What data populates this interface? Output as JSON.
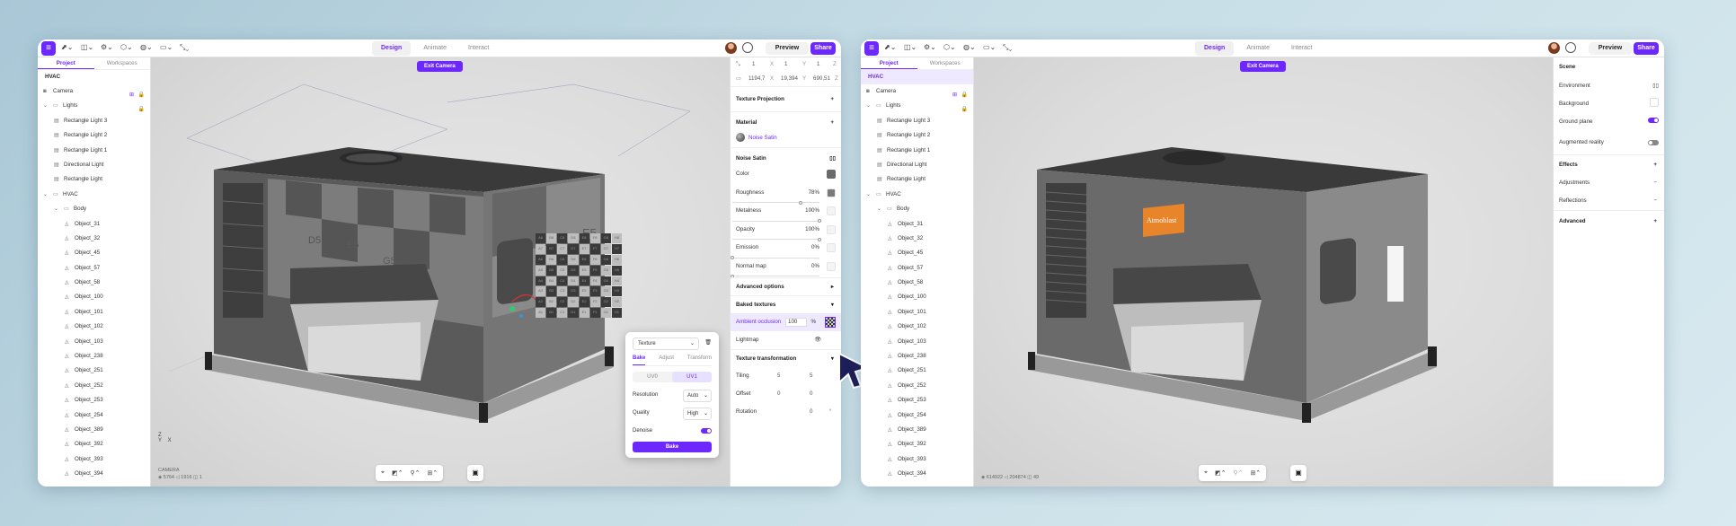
{
  "topbar": {
    "modes": [
      "Design",
      "Animate",
      "Interact"
    ],
    "preview_label": "Preview",
    "share_label": "Share"
  },
  "left_panel": {
    "tabs": [
      "Project",
      "Workspaces"
    ],
    "root_title": "HVAC",
    "items": [
      {
        "label": "Camera",
        "indent": 0,
        "icon": "camera-icon"
      },
      {
        "label": "Lights",
        "indent": 0,
        "icon": "folder-icon",
        "chevron": true
      },
      {
        "label": "Rectangle Light 3",
        "indent": 1,
        "icon": "light-icon"
      },
      {
        "label": "Rectangle Light 2",
        "indent": 1,
        "icon": "light-icon"
      },
      {
        "label": "Rectangle Light 1",
        "indent": 1,
        "icon": "light-icon"
      },
      {
        "label": "Directional Light",
        "indent": 1,
        "icon": "light-icon"
      },
      {
        "label": "Rectangle Light",
        "indent": 1,
        "icon": "light-icon"
      },
      {
        "label": "HVAC",
        "indent": 0,
        "icon": "folder-icon",
        "chevron": true
      },
      {
        "label": "Body",
        "indent": 1,
        "icon": "folder-icon",
        "chevron": true
      },
      {
        "label": "Object_31",
        "indent": 2,
        "icon": "mesh-icon"
      },
      {
        "label": "Object_32",
        "indent": 2,
        "icon": "mesh-icon"
      },
      {
        "label": "Object_45",
        "indent": 2,
        "icon": "mesh-icon"
      },
      {
        "label": "Object_57",
        "indent": 2,
        "icon": "mesh-icon"
      },
      {
        "label": "Object_58",
        "indent": 2,
        "icon": "mesh-icon"
      },
      {
        "label": "Object_100",
        "indent": 2,
        "icon": "mesh-icon"
      },
      {
        "label": "Object_101",
        "indent": 2,
        "icon": "mesh-icon"
      },
      {
        "label": "Object_102",
        "indent": 2,
        "icon": "mesh-icon"
      },
      {
        "label": "Object_103",
        "indent": 2,
        "icon": "mesh-icon"
      },
      {
        "label": "Object_238",
        "indent": 2,
        "icon": "mesh-icon"
      },
      {
        "label": "Object_251",
        "indent": 2,
        "icon": "mesh-icon"
      },
      {
        "label": "Object_252",
        "indent": 2,
        "icon": "mesh-icon"
      },
      {
        "label": "Object_253",
        "indent": 2,
        "icon": "mesh-icon"
      },
      {
        "label": "Object_254",
        "indent": 2,
        "icon": "mesh-icon"
      },
      {
        "label": "Object_389",
        "indent": 2,
        "icon": "mesh-icon"
      },
      {
        "label": "Object_392",
        "indent": 2,
        "icon": "mesh-icon"
      },
      {
        "label": "Object_393",
        "indent": 2,
        "icon": "mesh-icon"
      },
      {
        "label": "Object_394",
        "indent": 2,
        "icon": "mesh-icon"
      }
    ]
  },
  "viewport": {
    "exit_camera_label": "Exit Camera",
    "axis_labels": {
      "z": "Z",
      "y": "Y",
      "x": "X"
    },
    "checker_cells": [
      [
        "A8",
        "B8",
        "C8",
        "D8",
        "E8",
        "F8",
        "G8",
        "H8"
      ],
      [
        "A7",
        "B7",
        "C7",
        "D7",
        "E7",
        "F7",
        "G7",
        "H7"
      ],
      [
        "A6",
        "B6",
        "C6",
        "D6",
        "E6",
        "F6",
        "G6",
        "H6"
      ],
      [
        "A5",
        "B5",
        "C5",
        "D5",
        "E5",
        "F5",
        "G5",
        "H5"
      ],
      [
        "A4",
        "B4",
        "C4",
        "D4",
        "E4",
        "F4",
        "G4",
        "H4"
      ],
      [
        "A3",
        "B3",
        "C3",
        "D3",
        "E3",
        "F3",
        "G3",
        "H3"
      ],
      [
        "A2",
        "B2",
        "C2",
        "D2",
        "E2",
        "F2",
        "G2",
        "H2"
      ],
      [
        "A1",
        "B1",
        "C1",
        "D1",
        "E1",
        "F1",
        "G1",
        "H1"
      ]
    ],
    "model_labels": [
      "D5",
      "E5",
      "G5",
      "C5",
      "D5",
      "E5",
      "D4",
      "E4"
    ],
    "brand_label": "Atmoblast"
  },
  "window1": {
    "camera_title": "CAMERA",
    "stats": "◈ 5764   ◁ 1916   ◫ 1",
    "right_panel": {
      "coords_row1": [
        "1",
        "X",
        "1",
        "Y",
        "1",
        "Z"
      ],
      "coords_row2": [
        "1194,7",
        "X",
        "19,394",
        "Y",
        "690,51",
        "Z"
      ],
      "texture_projection": "Texture Projection",
      "material_header": "Material",
      "material_name": "Noise Satin",
      "section_name": "Noise Satin",
      "props": [
        {
          "label": "Color",
          "value": ""
        },
        {
          "label": "Roughness",
          "value": "78%"
        },
        {
          "label": "Metalness",
          "value": "100%"
        },
        {
          "label": "Opacity",
          "value": "100%"
        },
        {
          "label": "Emission",
          "value": "0%"
        },
        {
          "label": "Normal map",
          "value": "0%"
        }
      ],
      "advanced_options": "Advanced options",
      "baked_textures": "Baked textures",
      "ambient_occlusion": "Ambient occlusion",
      "ao_value": "100",
      "ao_unit": "%",
      "lightmap": "Lightmap",
      "texture_transformation": "Texture transformation",
      "tiling_label": "Tiling",
      "tiling_values": [
        "5",
        "5"
      ],
      "offset_label": "Offset",
      "offset_values": [
        "0",
        "0"
      ],
      "rotation_label": "Rotation",
      "rotation_value": "0",
      "rotation_unit": "°"
    },
    "popup": {
      "title": "Texture",
      "tabs": [
        "Bake",
        "Adjust",
        "Transform"
      ],
      "uv_tabs": [
        "UV0",
        "UV1"
      ],
      "resolution_label": "Resolution",
      "resolution_value": "Auto",
      "quality_label": "Quality",
      "quality_value": "High",
      "denoise_label": "Denoise",
      "bake_button": "Bake"
    }
  },
  "window2": {
    "stats": "◈ 614922   ◁ 204874   ◫ 49",
    "right_panel": {
      "scene": "Scene",
      "environment": "Environment",
      "background": "Background",
      "ground_plane": "Ground plane",
      "augmented_reality": "Augmented reality",
      "effects": "Effects",
      "adjustments": "Adjustments",
      "reflections": "Reflections",
      "advanced": "Advanced"
    }
  },
  "colors": {
    "accent": "#6d28ff",
    "panel": "#ffffff",
    "viewport": "#dcdcdc"
  }
}
